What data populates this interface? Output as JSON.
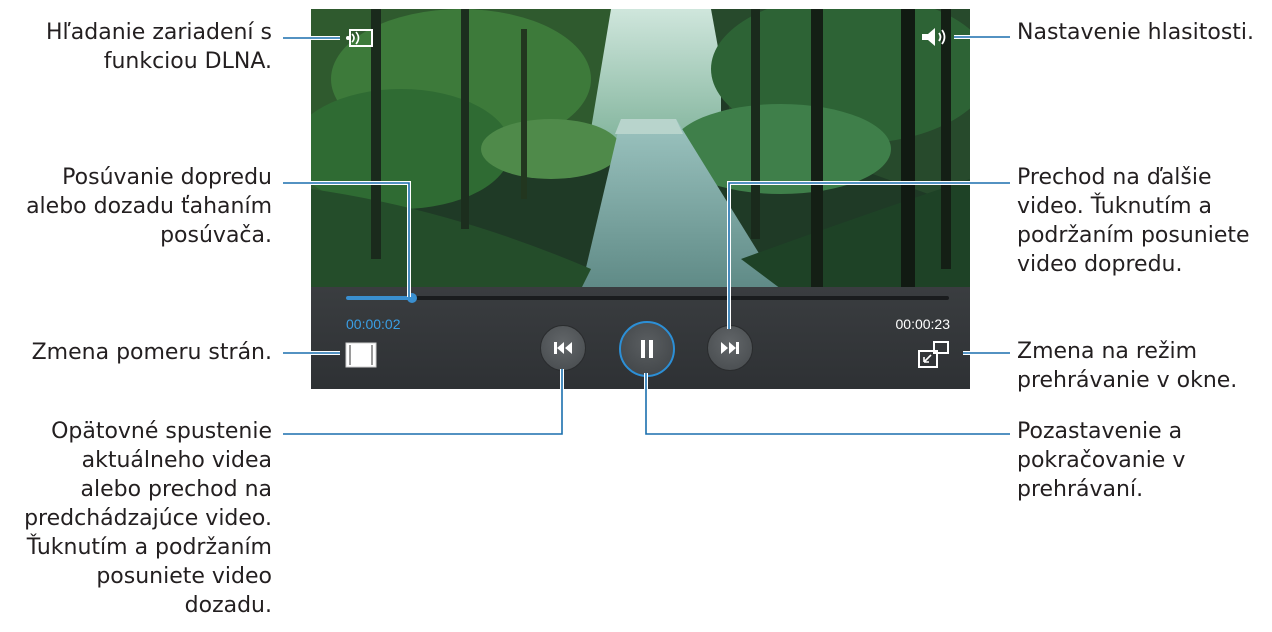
{
  "player": {
    "elapsed_time": "00:00:02",
    "total_time": "00:00:23",
    "progress_fraction": 0.11,
    "accent_color": "#2c8fd6"
  },
  "callouts": {
    "dlna_search": [
      "Hľadanie zariadení s",
      "funkciou DLNA."
    ],
    "seek_drag": [
      "Posúvanie dopredu",
      "alebo dozadu ťahaním",
      "posúvača."
    ],
    "aspect_ratio": [
      "Zmena pomeru strán."
    ],
    "restart_prev": [
      "Opätovné spustenie",
      "aktuálneho videa",
      "alebo prechod na",
      "predchádzajúce video.",
      "Ťuknutím a podržaním",
      "posuniete video",
      "dozadu."
    ],
    "volume": [
      "Nastavenie hlasitosti."
    ],
    "next_video": [
      "Prechod na ďalšie",
      "video. Ťuknutím a",
      "podržaním posuniete",
      "video dopredu."
    ],
    "popup_mode": [
      "Zmena na režim",
      "prehrávanie v okne."
    ],
    "pause_resume": [
      "Pozastavenie a",
      "pokračovanie v",
      "prehrávaní."
    ]
  },
  "icons": {
    "dlna": "dlna-cast-icon",
    "volume": "volume-icon",
    "aspect": "aspect-ratio-icon",
    "previous": "previous-track-icon",
    "pause": "pause-icon",
    "next": "next-track-icon",
    "popup": "popup-player-icon"
  },
  "leader_color": "#1a6fae"
}
